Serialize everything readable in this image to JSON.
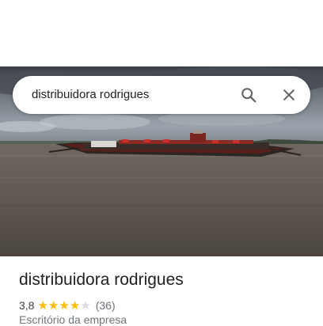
{
  "search": {
    "query": "distribuidora rodrigues"
  },
  "icons": {
    "search": "search-icon",
    "close": "close-icon"
  },
  "place": {
    "name": "distribuidora rodrigues",
    "rating": "3,8",
    "rating_value": 3.8,
    "reviews": "(36)",
    "category": "Escritório da empresa"
  },
  "colors": {
    "star": "#fbbc04",
    "star_empty": "#dadce0",
    "text": "#202124",
    "muted": "#70757a"
  }
}
